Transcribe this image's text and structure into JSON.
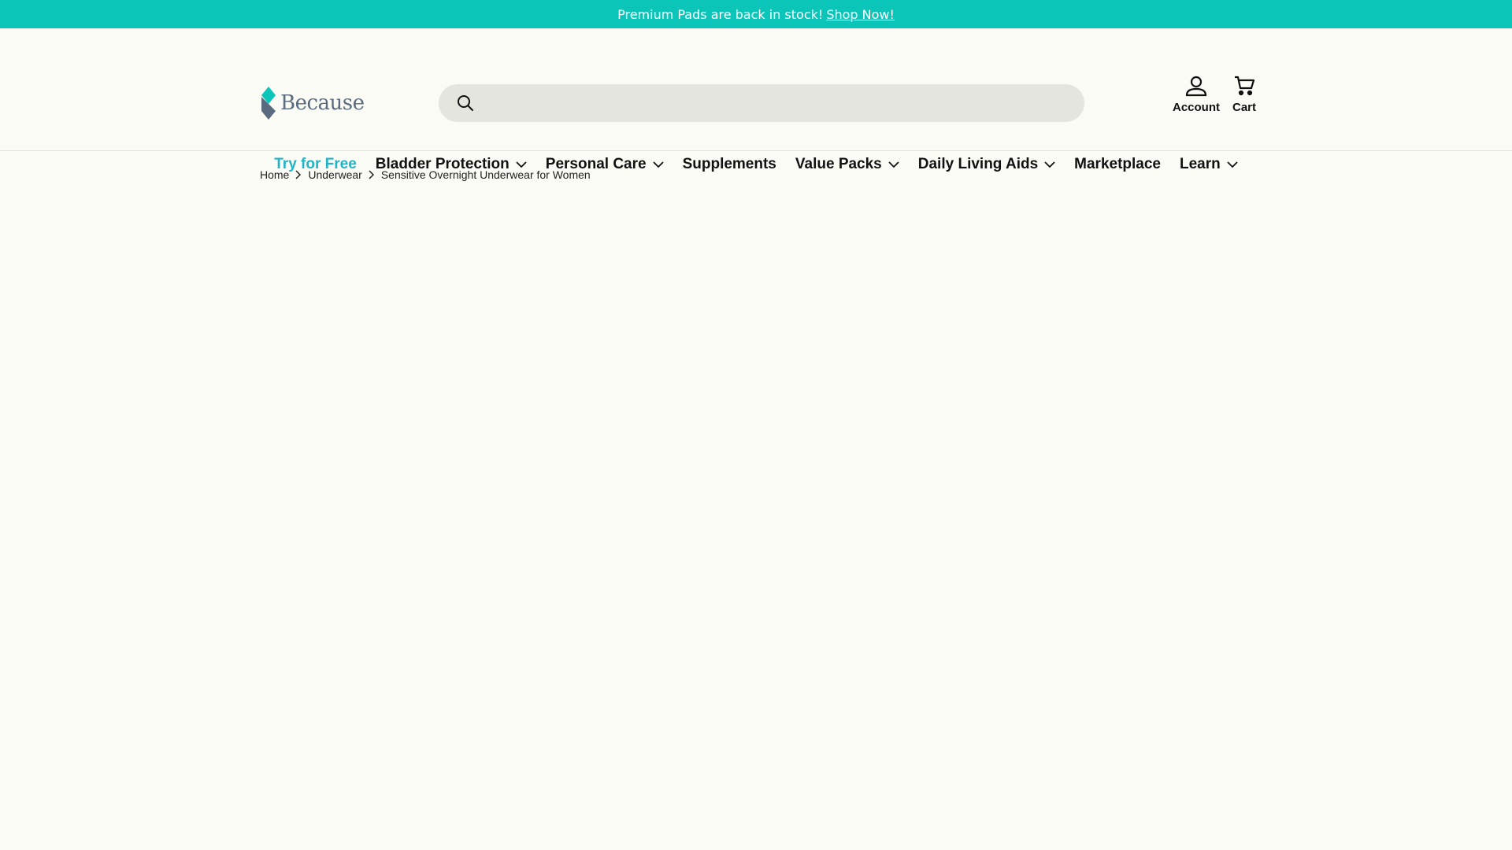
{
  "announcement": {
    "text": "Premium Pads are back in stock!",
    "link": "Shop Now!"
  },
  "logo": {
    "text": "Because"
  },
  "search": {
    "placeholder": ""
  },
  "header_actions": {
    "account": "Account",
    "cart": "Cart"
  },
  "nav": {
    "items": [
      {
        "label": "Try for Free"
      },
      {
        "label": "Bladder Protection"
      },
      {
        "label": "Personal Care"
      },
      {
        "label": "Supplements"
      },
      {
        "label": "Value Packs"
      },
      {
        "label": "Daily Living Aids"
      },
      {
        "label": "Marketplace"
      },
      {
        "label": "Learn"
      }
    ]
  },
  "breadcrumb": {
    "items": [
      "Home",
      "Underwear",
      "Sensitive Overnight Underwear for Women"
    ]
  },
  "colors": {
    "announcement_bg": "#0cc5b9",
    "accent": "#23b3c6",
    "background": "#fbfbf5",
    "search_bg": "#e5e5df"
  }
}
